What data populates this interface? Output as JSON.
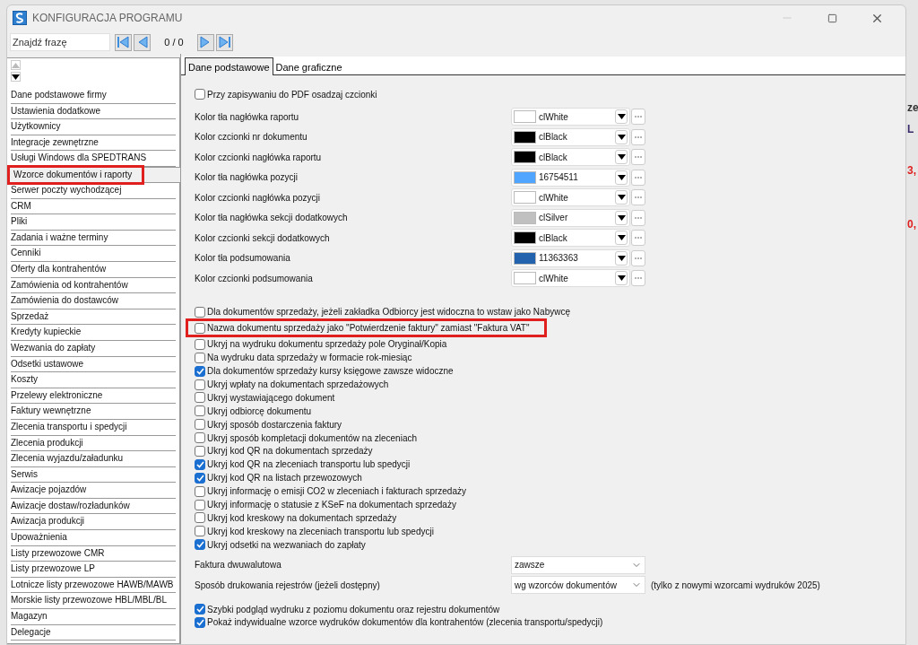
{
  "window": {
    "title": "KONFIGURACJA PROGRAMU"
  },
  "toolbar": {
    "search": {
      "placeholder": "Znajdź frazę"
    },
    "counter": "0 / 0"
  },
  "sidebar": {
    "items": [
      {
        "label": "Dane podstawowe firmy",
        "selected": false,
        "highlighted": false
      },
      {
        "label": "Ustawienia dodatkowe",
        "selected": false,
        "highlighted": false
      },
      {
        "label": "Użytkownicy",
        "selected": false,
        "highlighted": false
      },
      {
        "label": "Integracje zewnętrzne",
        "selected": false,
        "highlighted": false
      },
      {
        "label": "Usługi Windows dla SPEDTRANS",
        "selected": false,
        "highlighted": false
      },
      {
        "label": "Wzorce dokumentów i raporty",
        "selected": true,
        "highlighted": true
      },
      {
        "label": "Serwer poczty wychodzącej",
        "selected": false,
        "highlighted": false
      },
      {
        "label": "CRM",
        "selected": false,
        "highlighted": false
      },
      {
        "label": "Pliki",
        "selected": false,
        "highlighted": false
      },
      {
        "label": "Zadania i ważne terminy",
        "selected": false,
        "highlighted": false
      },
      {
        "label": "Cenniki",
        "selected": false,
        "highlighted": false
      },
      {
        "label": "Oferty dla kontrahentów",
        "selected": false,
        "highlighted": false
      },
      {
        "label": "Zamówienia od kontrahentów",
        "selected": false,
        "highlighted": false
      },
      {
        "label": "Zamówienia do dostawców",
        "selected": false,
        "highlighted": false
      },
      {
        "label": "Sprzedaż",
        "selected": false,
        "highlighted": false
      },
      {
        "label": "Kredyty kupieckie",
        "selected": false,
        "highlighted": false
      },
      {
        "label": "Wezwania do zapłaty",
        "selected": false,
        "highlighted": false
      },
      {
        "label": "Odsetki ustawowe",
        "selected": false,
        "highlighted": false
      },
      {
        "label": "Koszty",
        "selected": false,
        "highlighted": false
      },
      {
        "label": "Przelewy elektroniczne",
        "selected": false,
        "highlighted": false
      },
      {
        "label": "Faktury wewnętrzne",
        "selected": false,
        "highlighted": false
      },
      {
        "label": "Zlecenia transportu i spedycji",
        "selected": false,
        "highlighted": false
      },
      {
        "label": "Zlecenia produkcji",
        "selected": false,
        "highlighted": false
      },
      {
        "label": "Zlecenia wyjazdu/załadunku",
        "selected": false,
        "highlighted": false
      },
      {
        "label": "Serwis",
        "selected": false,
        "highlighted": false
      },
      {
        "label": "Awizacje pojazdów",
        "selected": false,
        "highlighted": false
      },
      {
        "label": "Awizacje dostaw/rozładunków",
        "selected": false,
        "highlighted": false
      },
      {
        "label": "Awizacja produkcji",
        "selected": false,
        "highlighted": false
      },
      {
        "label": "Upoważnienia",
        "selected": false,
        "highlighted": false
      },
      {
        "label": "Listy przewozowe CMR",
        "selected": false,
        "highlighted": false
      },
      {
        "label": "Listy przewozowe LP",
        "selected": false,
        "highlighted": false
      },
      {
        "label": "Lotnicze listy przewozowe HAWB/MAWB",
        "selected": false,
        "highlighted": false
      },
      {
        "label": "Morskie listy przewozowe HBL/MBL/BL",
        "selected": false,
        "highlighted": false
      },
      {
        "label": "Magazyn",
        "selected": false,
        "highlighted": false
      },
      {
        "label": "Delegacje",
        "selected": false,
        "highlighted": false
      }
    ]
  },
  "tabs": [
    {
      "label": "Dane podstawowe",
      "selected": true
    },
    {
      "label": "Dane graficzne",
      "selected": false
    }
  ],
  "top_option": {
    "label": "Przy zapisywaniu do PDF osadzaj czcionki",
    "checked": false
  },
  "color_rows": [
    {
      "label": "Kolor tła nagłówka raportu",
      "value": "clWhite",
      "color": "#ffffff"
    },
    {
      "label": "Kolor czcionki nr dokumentu",
      "value": "clBlack",
      "color": "#000000"
    },
    {
      "label": "Kolor czcionki nagłówka raportu",
      "value": "clBlack",
      "color": "#000000"
    },
    {
      "label": "Kolor tła nagłówka pozycji",
      "value": "16754511",
      "color": "#4fa5ff"
    },
    {
      "label": "Kolor czcionki nagłówka pozycji",
      "value": "clWhite",
      "color": "#ffffff"
    },
    {
      "label": "Kolor tła nagłówka sekcji dodatkowych",
      "value": "clSilver",
      "color": "#c0c0c0"
    },
    {
      "label": "Kolor czcionki sekcji dodatkowych",
      "value": "clBlack",
      "color": "#000000"
    },
    {
      "label": "Kolor tła podsumowania",
      "value": "11363363",
      "color": "#2362ad"
    },
    {
      "label": "Kolor czcionki podsumowania",
      "value": "clWhite",
      "color": "#ffffff"
    }
  ],
  "options": [
    {
      "label": "Dla dokumentów sprzedaży, jeżeli zakładka Odbiorcy jest widoczna to wstaw jako Nabywcę",
      "checked": false,
      "highlighted": false
    },
    {
      "label": "Nazwa dokumentu sprzedaży jako \"Potwierdzenie faktury\" zamiast \"Faktura VAT\"",
      "checked": false,
      "highlighted": true
    },
    {
      "label": "Ukryj na wydruku dokumentu sprzedaży pole Oryginał/Kopia",
      "checked": false,
      "highlighted": false
    },
    {
      "label": "Na wydruku data sprzedaży w formacie rok-miesiąc",
      "checked": false,
      "highlighted": false
    },
    {
      "label": "Dla dokumentów sprzedaży kursy księgowe zawsze widoczne",
      "checked": true,
      "highlighted": false
    },
    {
      "label": "Ukryj wpłaty na dokumentach sprzedażowych",
      "checked": false,
      "highlighted": false
    },
    {
      "label": "Ukryj wystawiającego dokument",
      "checked": false,
      "highlighted": false
    },
    {
      "label": "Ukryj odbiorcę dokumentu",
      "checked": false,
      "highlighted": false
    },
    {
      "label": "Ukryj sposób dostarczenia faktury",
      "checked": false,
      "highlighted": false
    },
    {
      "label": "Ukryj sposób kompletacji dokumentów na zleceniach",
      "checked": false,
      "highlighted": false
    },
    {
      "label": "Ukryj kod QR na dokumentach sprzedaży",
      "checked": false,
      "highlighted": false
    },
    {
      "label": "Ukryj kod QR na zleceniach transportu lub spedycji",
      "checked": true,
      "highlighted": false
    },
    {
      "label": "Ukryj kod QR na listach przewozowych",
      "checked": true,
      "highlighted": false
    },
    {
      "label": "Ukryj informację o emisji CO2 w zleceniach i fakturach sprzedaży",
      "checked": false,
      "highlighted": false
    },
    {
      "label": "Ukryj informację o statusie z KSeF na dokumentach sprzedaży",
      "checked": false,
      "highlighted": false
    },
    {
      "label": "Ukryj kod kreskowy na dokumentach sprzedaży",
      "checked": false,
      "highlighted": false
    },
    {
      "label": "Ukryj kod kreskowy na zleceniach transportu lub spedycji",
      "checked": false,
      "highlighted": false
    },
    {
      "label": "Ukryj odsetki na wezwaniach do zapłaty",
      "checked": true,
      "highlighted": false
    }
  ],
  "selects": [
    {
      "label": "Faktura dwuwalutowa",
      "value": "zawsze"
    },
    {
      "label": "Sposób drukowania rejestrów (jeżeli dostępny)",
      "value": "wg wzorców dokumentów",
      "note": "(tylko z nowymi wzorcami wydruków 2025)"
    }
  ],
  "bottom_options": [
    {
      "label": "Szybki podgląd wydruku z poziomu dokumentu oraz rejestru dokumentów",
      "checked": true
    },
    {
      "label": "Pokaż indywidualne wzorce wydruków dokumentów dla kontrahentów (zlecenia transportu/spedycji)",
      "checked": true
    }
  ],
  "background_fragments": [
    {
      "text": "ze",
      "color": "#333333"
    },
    {
      "text": "L",
      "color": "#3a2a6a"
    },
    {
      "text": "3,",
      "color": "#e02020"
    },
    {
      "text": "0,",
      "color": "#e02020"
    }
  ]
}
